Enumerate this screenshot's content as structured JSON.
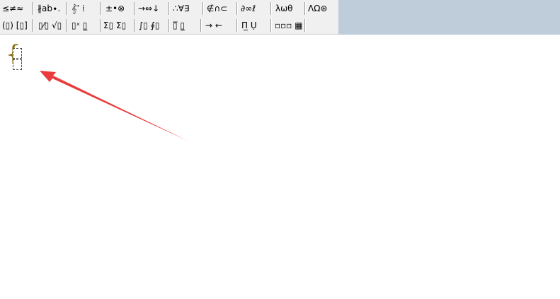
{
  "toolbar": {
    "row1": [
      {
        "name": "relations-palette-button",
        "label": "≤≠≈"
      },
      {
        "name": "spaces-ellipses-palette-button",
        "label": "∦ab∙."
      },
      {
        "name": "embellishments-palette-button",
        "label": "𝄞 ⃗ ⁞"
      },
      {
        "name": "operators-palette-button",
        "label": "±•⊗"
      },
      {
        "name": "arrows-palette-button",
        "label": "→⇔↓"
      },
      {
        "name": "logical-palette-button",
        "label": "∴∀∃"
      },
      {
        "name": "set-theory-palette-button",
        "label": "∉∩⊂"
      },
      {
        "name": "misc-symbols-palette-button",
        "label": "∂∞ℓ"
      },
      {
        "name": "greek-lowercase-palette-button",
        "label": "λωθ"
      },
      {
        "name": "greek-uppercase-palette-button",
        "label": "ΛΩ⊛"
      }
    ],
    "row2": [
      {
        "name": "fences-palette-button",
        "label": "(▯) [▯]"
      },
      {
        "name": "fractions-radicals-palette-button",
        "label": "▯⁄▯ √▯"
      },
      {
        "name": "scripts-palette-button",
        "label": "▯ˣ ▯̲"
      },
      {
        "name": "summation-palette-button",
        "label": "Σ▯ Σ▯"
      },
      {
        "name": "integrals-palette-button",
        "label": "∫▯ ∮▯"
      },
      {
        "name": "underbars-overbars-palette-button",
        "label": "▯̅ ▯̲"
      },
      {
        "name": "labeled-arrows-palette-button",
        "label": "→ ←"
      },
      {
        "name": "products-palette-button",
        "label": "Π̲ Ụ"
      },
      {
        "name": "matrices-palette-button",
        "label": "▫▫▫ ▦"
      }
    ]
  },
  "editor": {
    "brace": "{"
  },
  "annotation": {
    "arrow_color": "#ec3b3b"
  },
  "colors": {
    "toolbar_bg": "#f0f0f0",
    "toolbar_right_fill": "#bfcddb",
    "brace_color": "#8a6d00"
  }
}
